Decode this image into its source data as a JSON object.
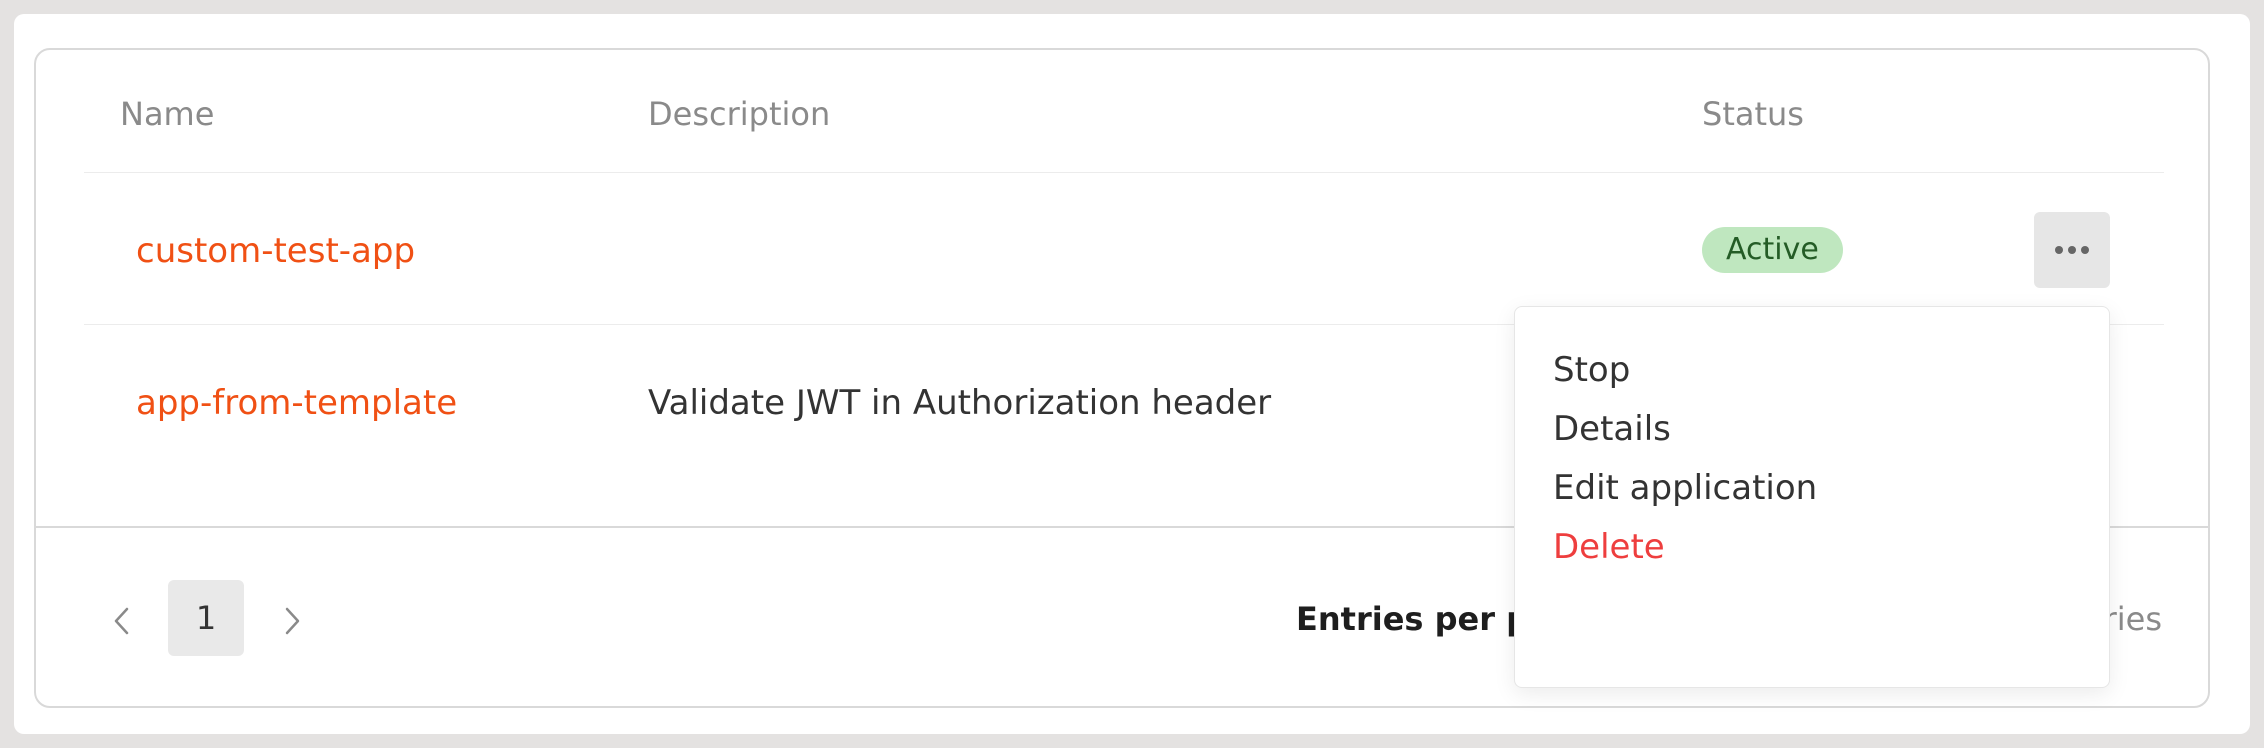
{
  "table": {
    "columns": {
      "name": "Name",
      "description": "Description",
      "status": "Status"
    },
    "rows": [
      {
        "name": "custom-test-app",
        "description": "",
        "status": "Active"
      },
      {
        "name": "app-from-template",
        "description": "Validate JWT in Authorization header",
        "status": ""
      }
    ]
  },
  "row_menu": {
    "items": [
      {
        "label": "Stop"
      },
      {
        "label": "Details"
      },
      {
        "label": "Edit application"
      },
      {
        "label": "Delete"
      }
    ]
  },
  "pagination": {
    "current_page": "1",
    "entries_per_page_label": "Entries per pa",
    "entries_total_text": "ries",
    "prev_icon": "chevron-left-icon",
    "next_icon": "chevron-right-icon"
  },
  "colors": {
    "link": "#f05014",
    "active_badge_bg": "#bfe7bf",
    "active_badge_text": "#245c26",
    "danger": "#ee3e3e"
  }
}
